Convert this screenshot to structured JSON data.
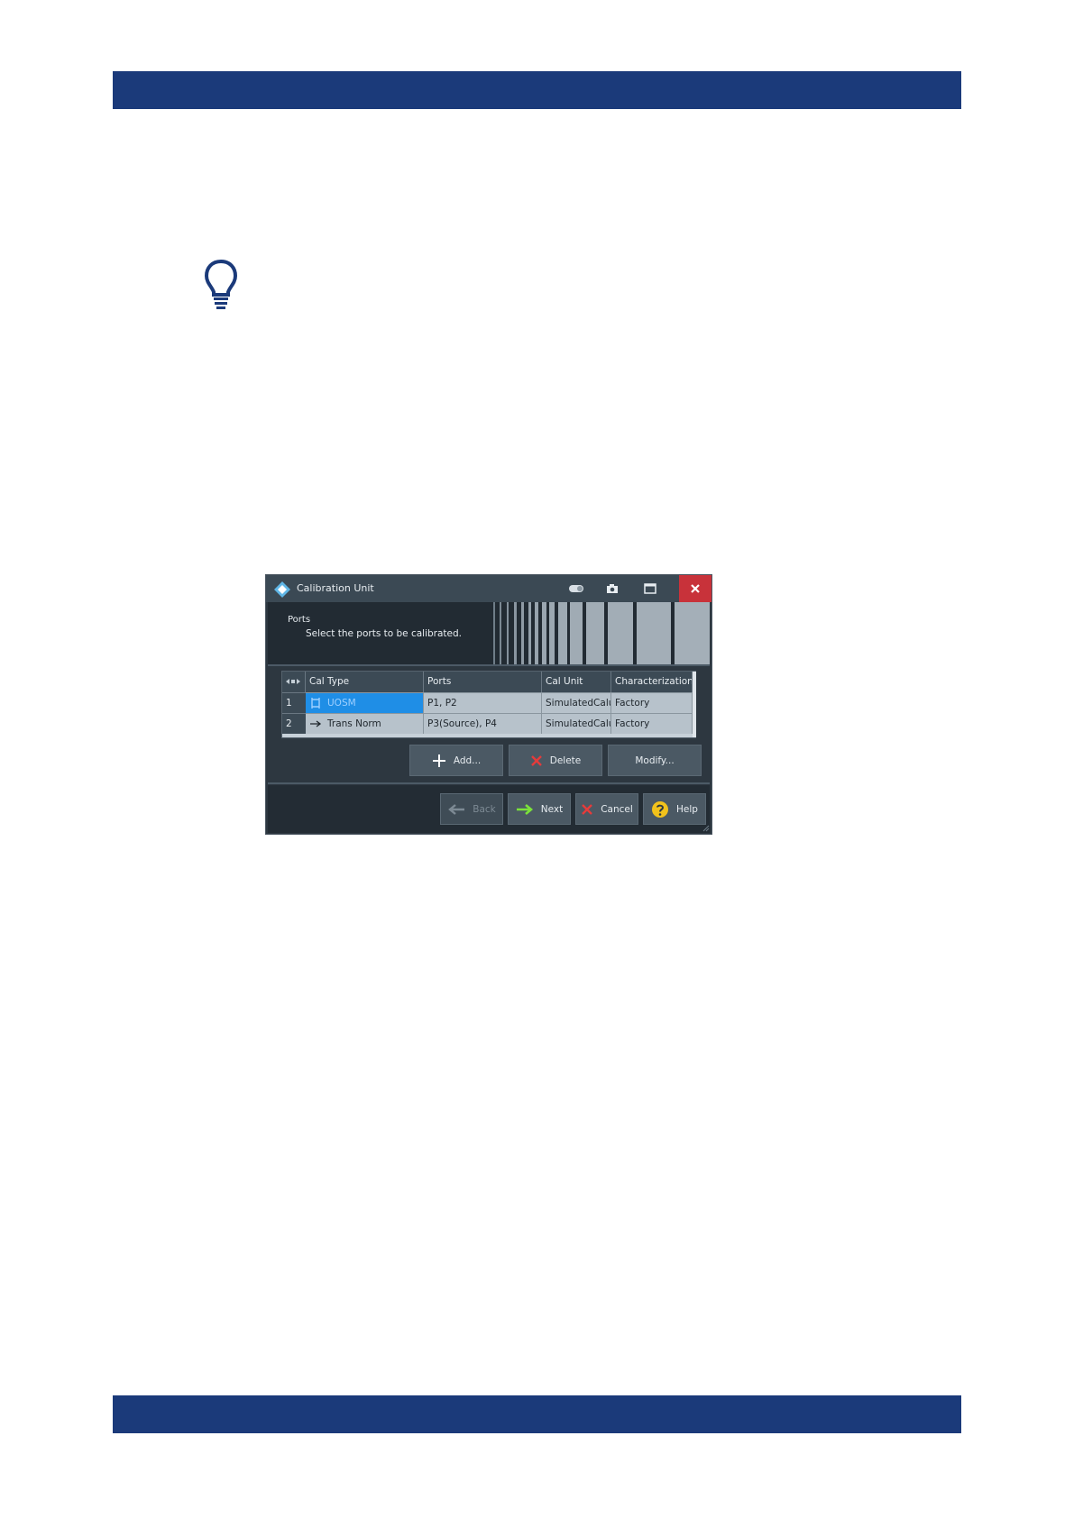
{
  "colors": {
    "band": "#1b3a7a",
    "bulb": "#1b3a7a",
    "dialog_bg": "#2d3740",
    "selection": "#1f8ee6",
    "close_button": "#c8323a",
    "next_arrow": "#7be23a",
    "delete_x": "#e53b3b",
    "help_icon": "#f2c21b"
  },
  "dialog": {
    "title": "Calibration Unit",
    "header": {
      "title": "Ports",
      "subtitle": "Select the ports to be calibrated."
    },
    "table": {
      "columns": [
        "Cal Type",
        "Ports",
        "Cal Unit",
        "Characterization"
      ],
      "rows": [
        {
          "index": "1",
          "cal_type": "UOSM",
          "ports": "P1, P2",
          "cal_unit": "SimulatedCalu",
          "characterization": "Factory",
          "selected": true
        },
        {
          "index": "2",
          "cal_type": "Trans Norm",
          "ports": "P3(Source), P4",
          "cal_unit": "SimulatedCalu",
          "characterization": "Factory",
          "selected": false
        }
      ]
    },
    "actions": {
      "add": "Add...",
      "delete": "Delete",
      "modify": "Modify..."
    },
    "nav": {
      "back": "Back",
      "next": "Next",
      "cancel": "Cancel",
      "help": "Help"
    }
  }
}
